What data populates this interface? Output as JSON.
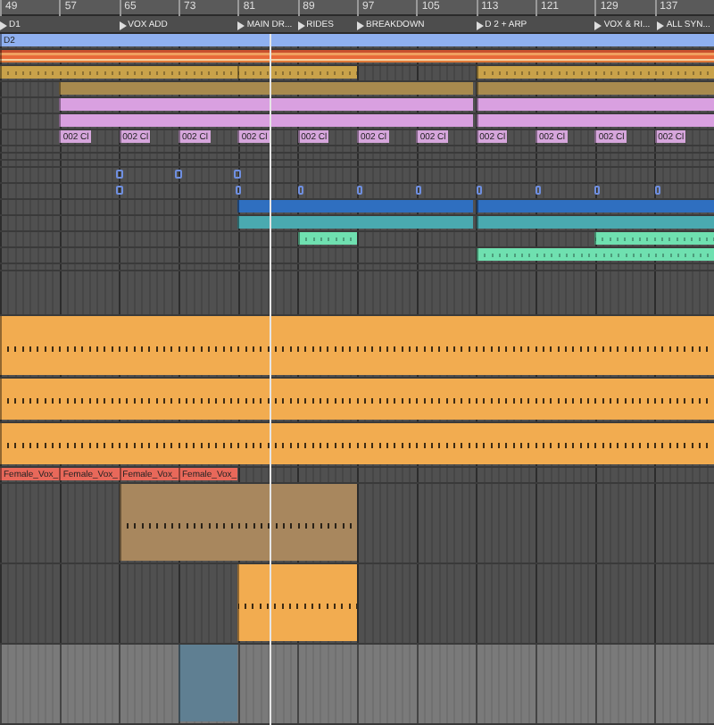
{
  "ruler": {
    "labels": [
      "49",
      "57",
      "65",
      "73",
      "81",
      "89",
      "97",
      "105",
      "113",
      "121",
      "129",
      "137"
    ]
  },
  "locators": [
    {
      "label": "D1"
    },
    {
      "label": "VOX ADD"
    },
    {
      "label": "MAIN DR..."
    },
    {
      "label": "RIDES"
    },
    {
      "label": "BREAKDOWN"
    },
    {
      "label": "D 2 + ARP"
    },
    {
      "label": "VOX & RI..."
    },
    {
      "label": "ALL SYN..."
    }
  ],
  "tracks": [
    {
      "kind": "normal",
      "selected": false,
      "clips": [
        {
          "kind": "audio",
          "color": "#8fb0f0",
          "label": "D2"
        }
      ]
    },
    {
      "kind": "normal",
      "selected": false,
      "clips": [
        {
          "kind": "stripes",
          "color": "#e07a3a"
        }
      ]
    },
    {
      "kind": "normal",
      "selected": false,
      "clips": [
        {
          "kind": "midi",
          "color": "#c9a24a"
        },
        {
          "kind": "midi",
          "color": "#c9a24a"
        },
        {
          "kind": "midi",
          "color": "#c9a24a"
        }
      ]
    },
    {
      "kind": "normal",
      "selected": false,
      "clips": [
        {
          "kind": "audio",
          "color": "#a88a4e"
        },
        {
          "kind": "audio",
          "color": "#a88a4e"
        }
      ]
    },
    {
      "kind": "normal",
      "selected": false,
      "clips": [
        {
          "kind": "audio",
          "color": "#d9a0e0"
        },
        {
          "kind": "audio",
          "color": "#d9a0e0"
        }
      ]
    },
    {
      "kind": "normal",
      "selected": false,
      "clips": [
        {
          "kind": "audio",
          "color": "#d9a0e0"
        },
        {
          "kind": "audio",
          "color": "#d9a0e0"
        }
      ]
    },
    {
      "kind": "normal",
      "selected": false,
      "clips": [
        {
          "kind": "audio",
          "color": "#d6a6dc",
          "label": "002 Cl"
        },
        {
          "kind": "audio",
          "color": "#d6a6dc",
          "label": "002 Cl"
        },
        {
          "kind": "audio",
          "color": "#d6a6dc",
          "label": "002 Cl"
        },
        {
          "kind": "audio",
          "color": "#d6a6dc",
          "label": "002 Cl"
        },
        {
          "kind": "audio",
          "color": "#d6a6dc",
          "label": "002 Cl"
        },
        {
          "kind": "audio",
          "color": "#d6a6dc",
          "label": "002 Cl"
        },
        {
          "kind": "audio",
          "color": "#d6a6dc",
          "label": "002 Cl"
        },
        {
          "kind": "audio",
          "color": "#d6a6dc",
          "label": "002 Cl"
        },
        {
          "kind": "audio",
          "color": "#d6a6dc",
          "label": "002 Cl"
        },
        {
          "kind": "audio",
          "color": "#d6a6dc",
          "label": "002 Cl"
        },
        {
          "kind": "audio",
          "color": "#d6a6dc",
          "label": "002 Cl"
        }
      ]
    },
    {
      "kind": "folded",
      "selected": false
    },
    {
      "kind": "folded",
      "selected": false
    },
    {
      "kind": "folded",
      "selected": false
    },
    {
      "kind": "normal",
      "selected": false,
      "clips": [
        {
          "kind": "marker",
          "color": "#6f8fe0"
        },
        {
          "kind": "marker",
          "color": "#6f8fe0"
        },
        {
          "kind": "marker",
          "color": "#6f8fe0"
        }
      ]
    },
    {
      "kind": "normal",
      "selected": false,
      "clips": [
        {
          "kind": "marker",
          "color": "#6f8fe0"
        },
        {
          "kind": "marker",
          "color": "#6f8fe0"
        },
        {
          "kind": "marker",
          "color": "#6f8fe0"
        },
        {
          "kind": "marker",
          "color": "#6f8fe0"
        },
        {
          "kind": "marker",
          "color": "#6f8fe0"
        },
        {
          "kind": "marker",
          "color": "#6f8fe0"
        },
        {
          "kind": "marker",
          "color": "#6f8fe0"
        },
        {
          "kind": "marker",
          "color": "#6f8fe0"
        },
        {
          "kind": "marker",
          "color": "#6f8fe0"
        }
      ]
    },
    {
      "kind": "normal",
      "selected": false,
      "clips": [
        {
          "kind": "audio",
          "color": "#2f6fc0"
        },
        {
          "kind": "audio",
          "color": "#2f6fc0"
        }
      ]
    },
    {
      "kind": "normal",
      "selected": false,
      "clips": [
        {
          "kind": "audio",
          "color": "#4aaab0"
        },
        {
          "kind": "audio",
          "color": "#4aaab0"
        }
      ]
    },
    {
      "kind": "normal",
      "selected": false,
      "clips": [
        {
          "kind": "midi",
          "color": "#6fe0b0"
        },
        {
          "kind": "midi",
          "color": "#6fe0b0"
        }
      ]
    },
    {
      "kind": "normal",
      "selected": false,
      "clips": [
        {
          "kind": "midi",
          "color": "#6fe0b0"
        }
      ]
    },
    {
      "kind": "folded",
      "selected": false
    },
    {
      "kind": "wide",
      "selected": false
    },
    {
      "kind": "huge",
      "selected": false,
      "clips": [
        {
          "kind": "midi",
          "color": "#f2ac50"
        }
      ]
    },
    {
      "kind": "wide",
      "selected": false,
      "clips": [
        {
          "kind": "midi",
          "color": "#f2ac50"
        }
      ]
    },
    {
      "kind": "wide",
      "selected": false,
      "clips": [
        {
          "kind": "midi",
          "color": "#f2ac50"
        }
      ]
    },
    {
      "kind": "normal",
      "selected": false,
      "clips": [
        {
          "kind": "audio",
          "color": "#e8685a",
          "label": "Female_Vox_"
        },
        {
          "kind": "audio",
          "color": "#e8685a",
          "label": "Female_Vox_"
        },
        {
          "kind": "audio",
          "color": "#e8685a",
          "label": "Female_Vox_"
        },
        {
          "kind": "audio",
          "color": "#e8685a",
          "label": "Female_Vox_"
        }
      ]
    },
    {
      "kind": "giant",
      "selected": false,
      "clips": [
        {
          "kind": "midi",
          "color": "#a8875e"
        }
      ]
    },
    {
      "kind": "giant",
      "selected": false,
      "clips": [
        {
          "kind": "midi",
          "color": "#f2ac50"
        }
      ]
    },
    {
      "kind": "giant",
      "selected": true,
      "clips": [
        {
          "kind": "audio",
          "color": "#5f7f92"
        }
      ]
    }
  ]
}
